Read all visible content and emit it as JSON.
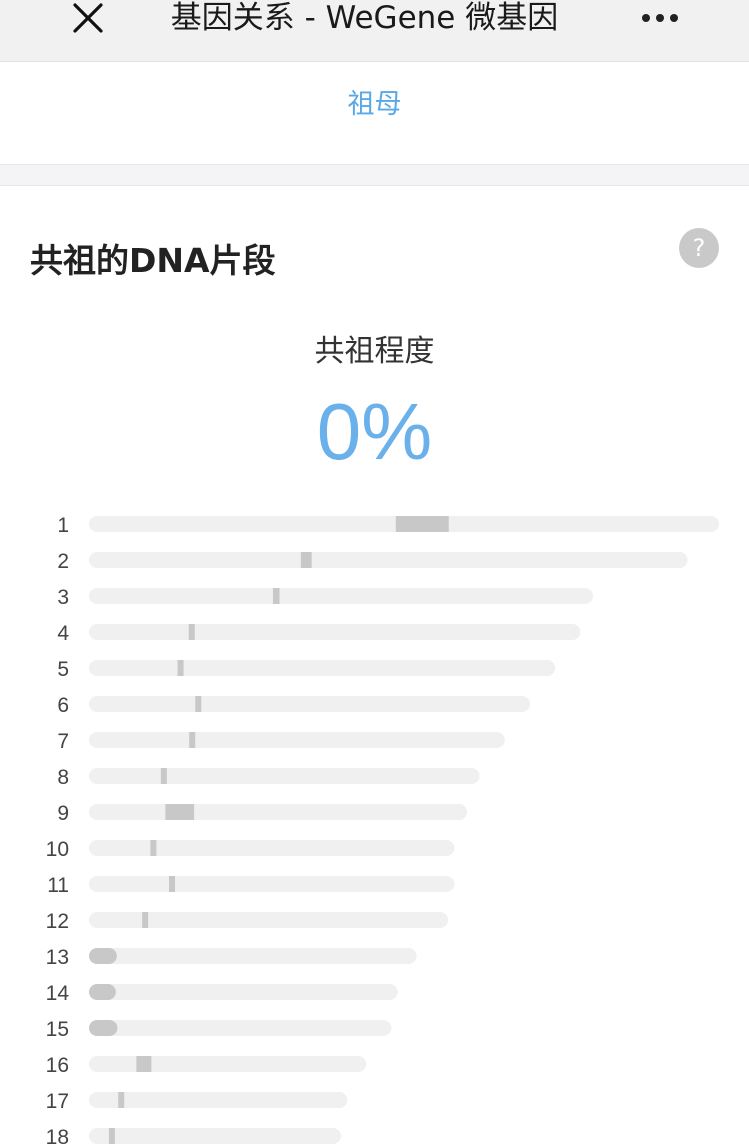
{
  "nav": {
    "title": "基因关系 - WeGene 微基因",
    "close_icon": "close-icon",
    "more_icon": "more-dots-icon"
  },
  "relation": {
    "label": "祖母"
  },
  "section": {
    "title": "共祖的DNA片段",
    "help_icon": "?",
    "share_label": "共祖程度",
    "share_value": "0%"
  },
  "colors": {
    "accent": "#5aa9e6",
    "bar_track": "#f0f0f0",
    "segment": "#c8c8c8"
  },
  "chart_data": {
    "type": "bar",
    "categories": [
      "1",
      "2",
      "3",
      "4",
      "5",
      "6",
      "7",
      "8",
      "9",
      "10",
      "11",
      "12",
      "13",
      "14",
      "15",
      "16",
      "17",
      "18"
    ],
    "chromosome_length_rel": [
      1.0,
      0.95,
      0.8,
      0.78,
      0.74,
      0.7,
      0.66,
      0.62,
      0.6,
      0.58,
      0.58,
      0.57,
      0.52,
      0.49,
      0.48,
      0.44,
      0.41,
      0.4
    ],
    "segments": [
      [
        [
          0.487,
          0.571
        ]
      ],
      [
        [
          0.354,
          0.372
        ]
      ],
      [
        [
          0.365,
          0.378
        ]
      ],
      [
        [
          0.203,
          0.214
        ]
      ],
      [
        [
          0.19,
          0.202
        ]
      ],
      [
        [
          0.241,
          0.254
        ]
      ],
      [
        [
          0.241,
          0.254
        ]
      ],
      [
        [
          0.184,
          0.198
        ]
      ],
      [
        [
          0.202,
          0.278
        ]
      ],
      [
        [
          0.168,
          0.181
        ]
      ],
      [
        [
          0.219,
          0.235
        ]
      ],
      [
        [
          0.148,
          0.162
        ]
      ],
      [
        [
          0.0,
          0.085
        ]
      ],
      [
        [
          0.0,
          0.087
        ]
      ],
      [
        [
          0.0,
          0.094
        ]
      ],
      [
        [
          0.171,
          0.225
        ]
      ],
      [
        [
          0.113,
          0.127
        ]
      ],
      [
        [
          0.079,
          0.094
        ]
      ]
    ]
  }
}
